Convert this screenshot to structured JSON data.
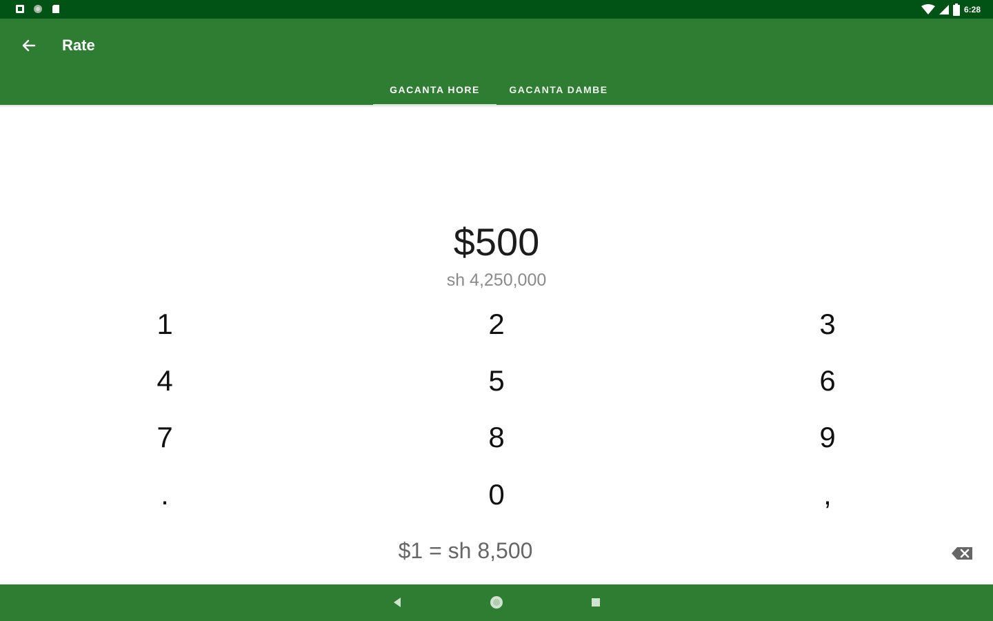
{
  "status_bar": {
    "time": "6:28",
    "icons": [
      "notification-icon",
      "sync-icon",
      "sd-card-icon",
      "wifi-icon",
      "cellular-icon",
      "battery-icon"
    ]
  },
  "app_bar": {
    "title": "Rate",
    "back_icon": "arrow-back-icon",
    "tabs": [
      {
        "label": "GACANTA HORE",
        "selected": true
      },
      {
        "label": "GACANTA DAMBE",
        "selected": false
      }
    ]
  },
  "display": {
    "amount": "$500",
    "converted": "sh 4,250,000"
  },
  "keypad": {
    "keys": [
      "1",
      "2",
      "3",
      "4",
      "5",
      "6",
      "7",
      "8",
      "9",
      ".",
      "0",
      ","
    ]
  },
  "footer": {
    "rate_text": "$1 = sh 8,500",
    "backspace_icon": "backspace-icon"
  },
  "nav_bar": {
    "buttons": [
      "nav-back-icon",
      "nav-home-icon",
      "nav-recents-icon"
    ]
  },
  "colors": {
    "primary": "#2e7d32",
    "primary_dark": "#005314",
    "text_secondary": "#8a8a8a"
  }
}
